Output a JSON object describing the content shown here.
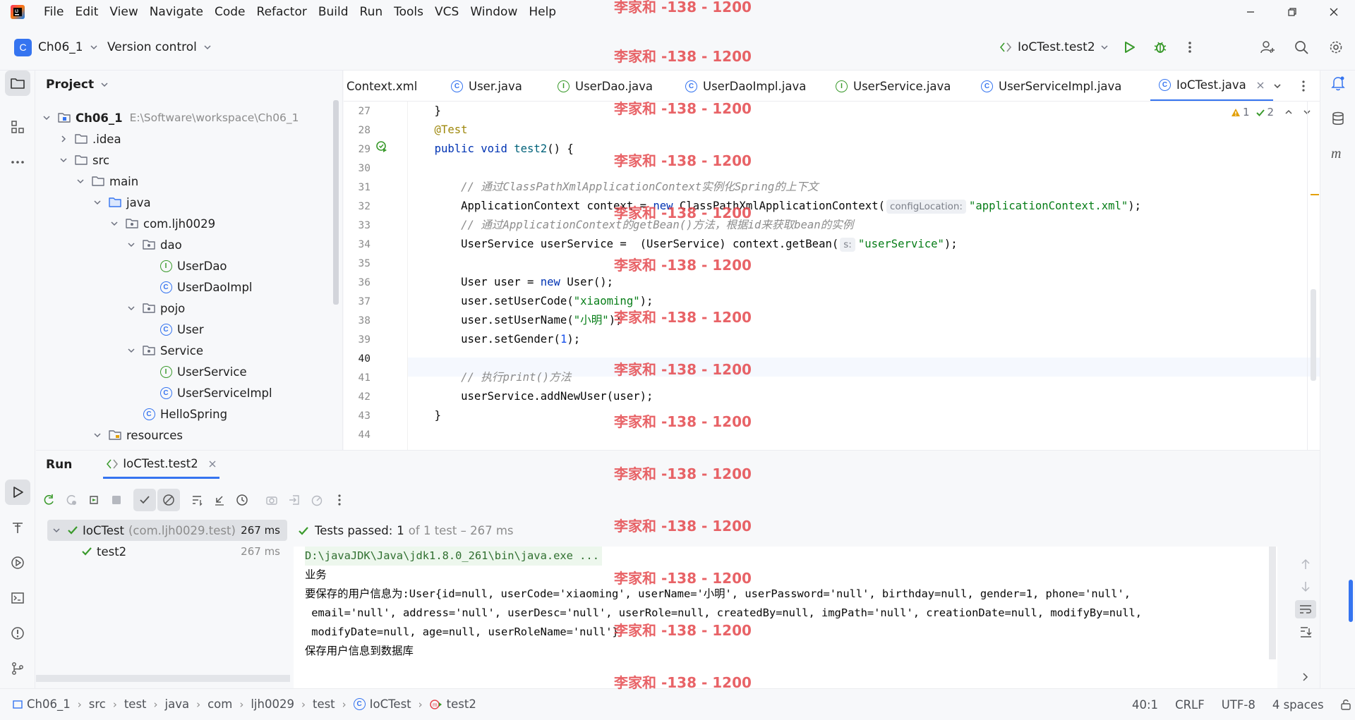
{
  "menu": [
    "File",
    "Edit",
    "View",
    "Navigate",
    "Code",
    "Refactor",
    "Build",
    "Run",
    "Tools",
    "VCS",
    "Window",
    "Help"
  ],
  "toolbar": {
    "project_name": "Ch06_1",
    "project_badge": "C",
    "vcs_label": "Version control",
    "run_config": "IoCTest.test2"
  },
  "project_panel": {
    "title": "Project",
    "tree": [
      {
        "label": "Ch06_1",
        "path": "E:\\Software\\workspace\\Ch06_1",
        "type": "module",
        "level": 0,
        "expanded": true
      },
      {
        "label": ".idea",
        "type": "folder",
        "level": 1,
        "expanded": false
      },
      {
        "label": "src",
        "type": "folder",
        "level": 1,
        "expanded": true
      },
      {
        "label": "main",
        "type": "folder",
        "level": 2,
        "expanded": true
      },
      {
        "label": "java",
        "type": "source-folder",
        "level": 3,
        "expanded": true
      },
      {
        "label": "com.ljh0029",
        "type": "package",
        "level": 4,
        "expanded": true
      },
      {
        "label": "dao",
        "type": "package",
        "level": 5,
        "expanded": true
      },
      {
        "label": "UserDao",
        "type": "interface",
        "level": 6
      },
      {
        "label": "UserDaoImpl",
        "type": "class",
        "level": 6
      },
      {
        "label": "pojo",
        "type": "package",
        "level": 5,
        "expanded": true
      },
      {
        "label": "User",
        "type": "class",
        "level": 6
      },
      {
        "label": "Service",
        "type": "package",
        "level": 5,
        "expanded": true
      },
      {
        "label": "UserService",
        "type": "interface",
        "level": 6
      },
      {
        "label": "UserServiceImpl",
        "type": "class",
        "level": 6
      },
      {
        "label": "HelloSpring",
        "type": "class",
        "level": 5
      },
      {
        "label": "resources",
        "type": "resources-folder",
        "level": 3,
        "expanded": true
      }
    ]
  },
  "editor": {
    "tabs": [
      {
        "label": "Context.xml",
        "icon": "xml-icon",
        "active": false
      },
      {
        "label": "User.java",
        "icon": "class-icon",
        "active": false
      },
      {
        "label": "UserDao.java",
        "icon": "interface-icon",
        "active": false
      },
      {
        "label": "UserDaoImpl.java",
        "icon": "class-icon",
        "active": false
      },
      {
        "label": "UserService.java",
        "icon": "interface-icon",
        "active": false
      },
      {
        "label": "UserServiceImpl.java",
        "icon": "class-icon",
        "active": false
      },
      {
        "label": "IoCTest.java",
        "icon": "class-icon",
        "active": true
      }
    ],
    "inspections": {
      "warnings": "1",
      "ok": "2"
    },
    "line_numbers": [
      "27",
      "28",
      "29",
      "30",
      "31",
      "32",
      "33",
      "34",
      "35",
      "36",
      "37",
      "38",
      "39",
      "40",
      "41",
      "42",
      "43",
      "44"
    ],
    "current_line": "40",
    "code": {
      "l27": "    }",
      "l28_ann": "    @Test",
      "l29_kw": "public",
      "l29_kw2": "void",
      "l29_fn": "test2",
      "l31_cm": "// 通过ClassPathXmlApplicationContext实例化Spring的上下文",
      "l32_a": "ApplicationContext context = ",
      "l32_kw": "new",
      "l32_b": " ClassPathXmlApplicationContext(",
      "l32_hint": "configLocation:",
      "l32_str": "\"applicationContext.xml\"",
      "l32_c": ");",
      "l33_cm": "// 通过ApplicationContext的getBean()方法，根据id来获取bean的实例",
      "l34_a": "UserService userService =  (UserService) context.getBean(",
      "l34_hint": "s:",
      "l34_str": "\"userService\"",
      "l34_c": ");",
      "l36_a": "User user = ",
      "l36_kw": "new",
      "l36_b": " User();",
      "l37_a": "user.setUserCode(",
      "l37_str": "\"xiaoming\"",
      "l37_c": ");",
      "l38_a": "user.setUserName(",
      "l38_str": "\"小明\"",
      "l38_c": ");",
      "l39_a": "user.setGender(",
      "l39_num": "1",
      "l39_c": ");",
      "l41_cm": "// 执行print()方法",
      "l42": "userService.addNewUser(user);",
      "l43": "}"
    }
  },
  "run_panel": {
    "title": "Run",
    "tab_label": "IoCTest.test2",
    "result_summary_bold": "Tests passed:",
    "result_summary_count": "1",
    "result_summary_rest": "of 1 test – 267 ms",
    "tests": [
      {
        "name": "IoCTest",
        "pkg": "(com.ljh0029.test)",
        "time": "267 ms"
      },
      {
        "name": "test2",
        "time": "267 ms"
      }
    ],
    "console": [
      "D:\\javaJDK\\Java\\jdk1.8.0_261\\bin\\java.exe ...",
      "业务",
      "要保存的用户信息为:User{id=null, userCode='xiaoming', userName='小明', userPassword='null', birthday=null, gender=1, phone='null',",
      " email='null', address='null', userDesc='null', userRole=null, createdBy=null, imgPath='null', creationDate=null, modifyBy=null,",
      " modifyDate=null, age=null, userRoleName='null'}",
      "保存用户信息到数据库"
    ]
  },
  "statusbar": {
    "breadcrumbs": [
      "Ch06_1",
      "src",
      "test",
      "java",
      "com",
      "ljh0029",
      "test",
      "IoCTest",
      "test2"
    ],
    "position": "40:1",
    "line_sep": "CRLF",
    "encoding": "UTF-8",
    "indent": "4 spaces"
  },
  "watermark": "李家和 -138 - 1200",
  "colors": {
    "accent": "#3574f0",
    "success": "#3a9a2c",
    "watermark": "#e5484d",
    "warning": "#e3a008"
  }
}
